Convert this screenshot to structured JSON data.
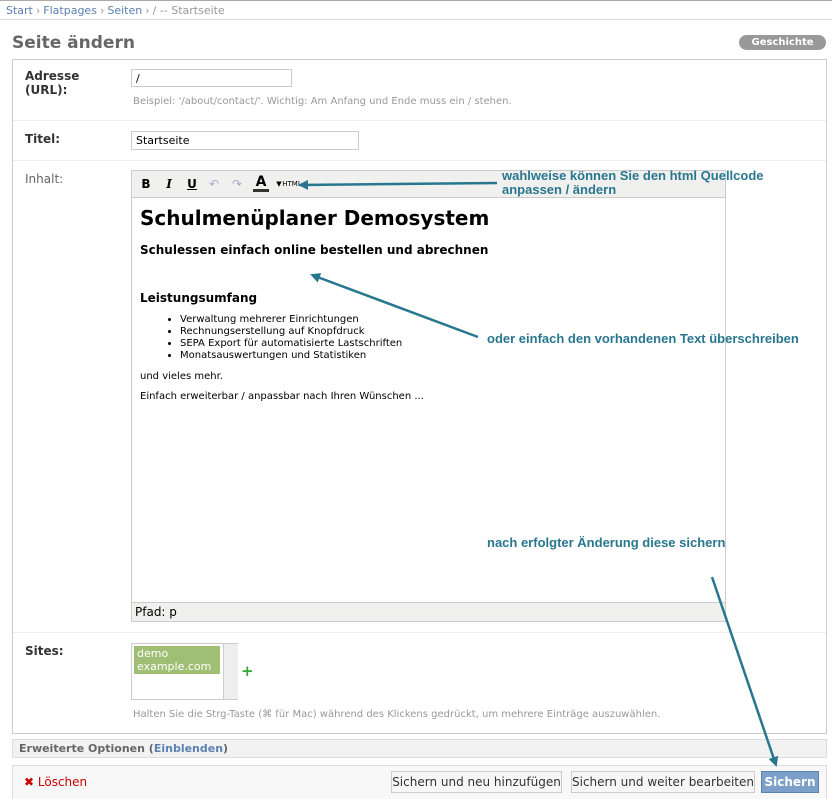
{
  "breadcrumbs": [
    "Start",
    "Flatpages",
    "Seiten",
    "/ -- Startseite"
  ],
  "title": "Seite ändern",
  "history_button": "Geschichte",
  "fields": {
    "address": {
      "label": "Adresse (URL):",
      "value": "/",
      "help": "Beispiel: '/about/contact/'. Wichtig: Am Anfang und Ende muss ein / stehen."
    },
    "title": {
      "label": "Titel:",
      "value": "Startseite"
    },
    "content": {
      "label": "Inhalt:"
    },
    "sites": {
      "label": "Sites:",
      "options": [
        "demo",
        "example.com"
      ],
      "help": "Halten Sie die Strg-Taste (⌘ für Mac) während des Klickens gedrückt, um mehrere Einträge auszuwählen."
    }
  },
  "editor": {
    "toolbar": {
      "bold": "B",
      "italic": "I",
      "underline": "U",
      "undo": "↶",
      "redo": "↷",
      "color": "A",
      "html": "HTML"
    },
    "heading": "Schulmenüplaner Demosystem",
    "subheading": "Schulessen einfach online bestellen und abrechnen",
    "section": "Leistungsumfang",
    "bullets": [
      "Verwaltung mehrerer Einrichtungen",
      "Rechnungserstellung auf Knopfdruck",
      "SEPA Export für automatisierte Lastschriften",
      "Monatsauswertungen und Statistiken"
    ],
    "p1": "und vieles mehr.",
    "p2": "Einfach erweiterbar / anpassbar nach Ihren Wünschen ...",
    "status": "Pfad: p"
  },
  "annotations": {
    "a1": "wahlweise können Sie den html Quellcode anpassen / ändern",
    "a2": "oder einfach den vorhandenen Text überschreiben",
    "a3": "nach erfolgter Änderung diese sichern"
  },
  "advanced": {
    "label": "Erweiterte Optionen",
    "link": "Einblenden"
  },
  "actions": {
    "delete": "Löschen",
    "save_add": "Sichern und neu hinzufügen",
    "save_continue": "Sichern und weiter bearbeiten",
    "save": "Sichern"
  },
  "colors": {
    "annotation": "#28778f",
    "link": "#5b80b2",
    "delete": "#cc0000"
  }
}
